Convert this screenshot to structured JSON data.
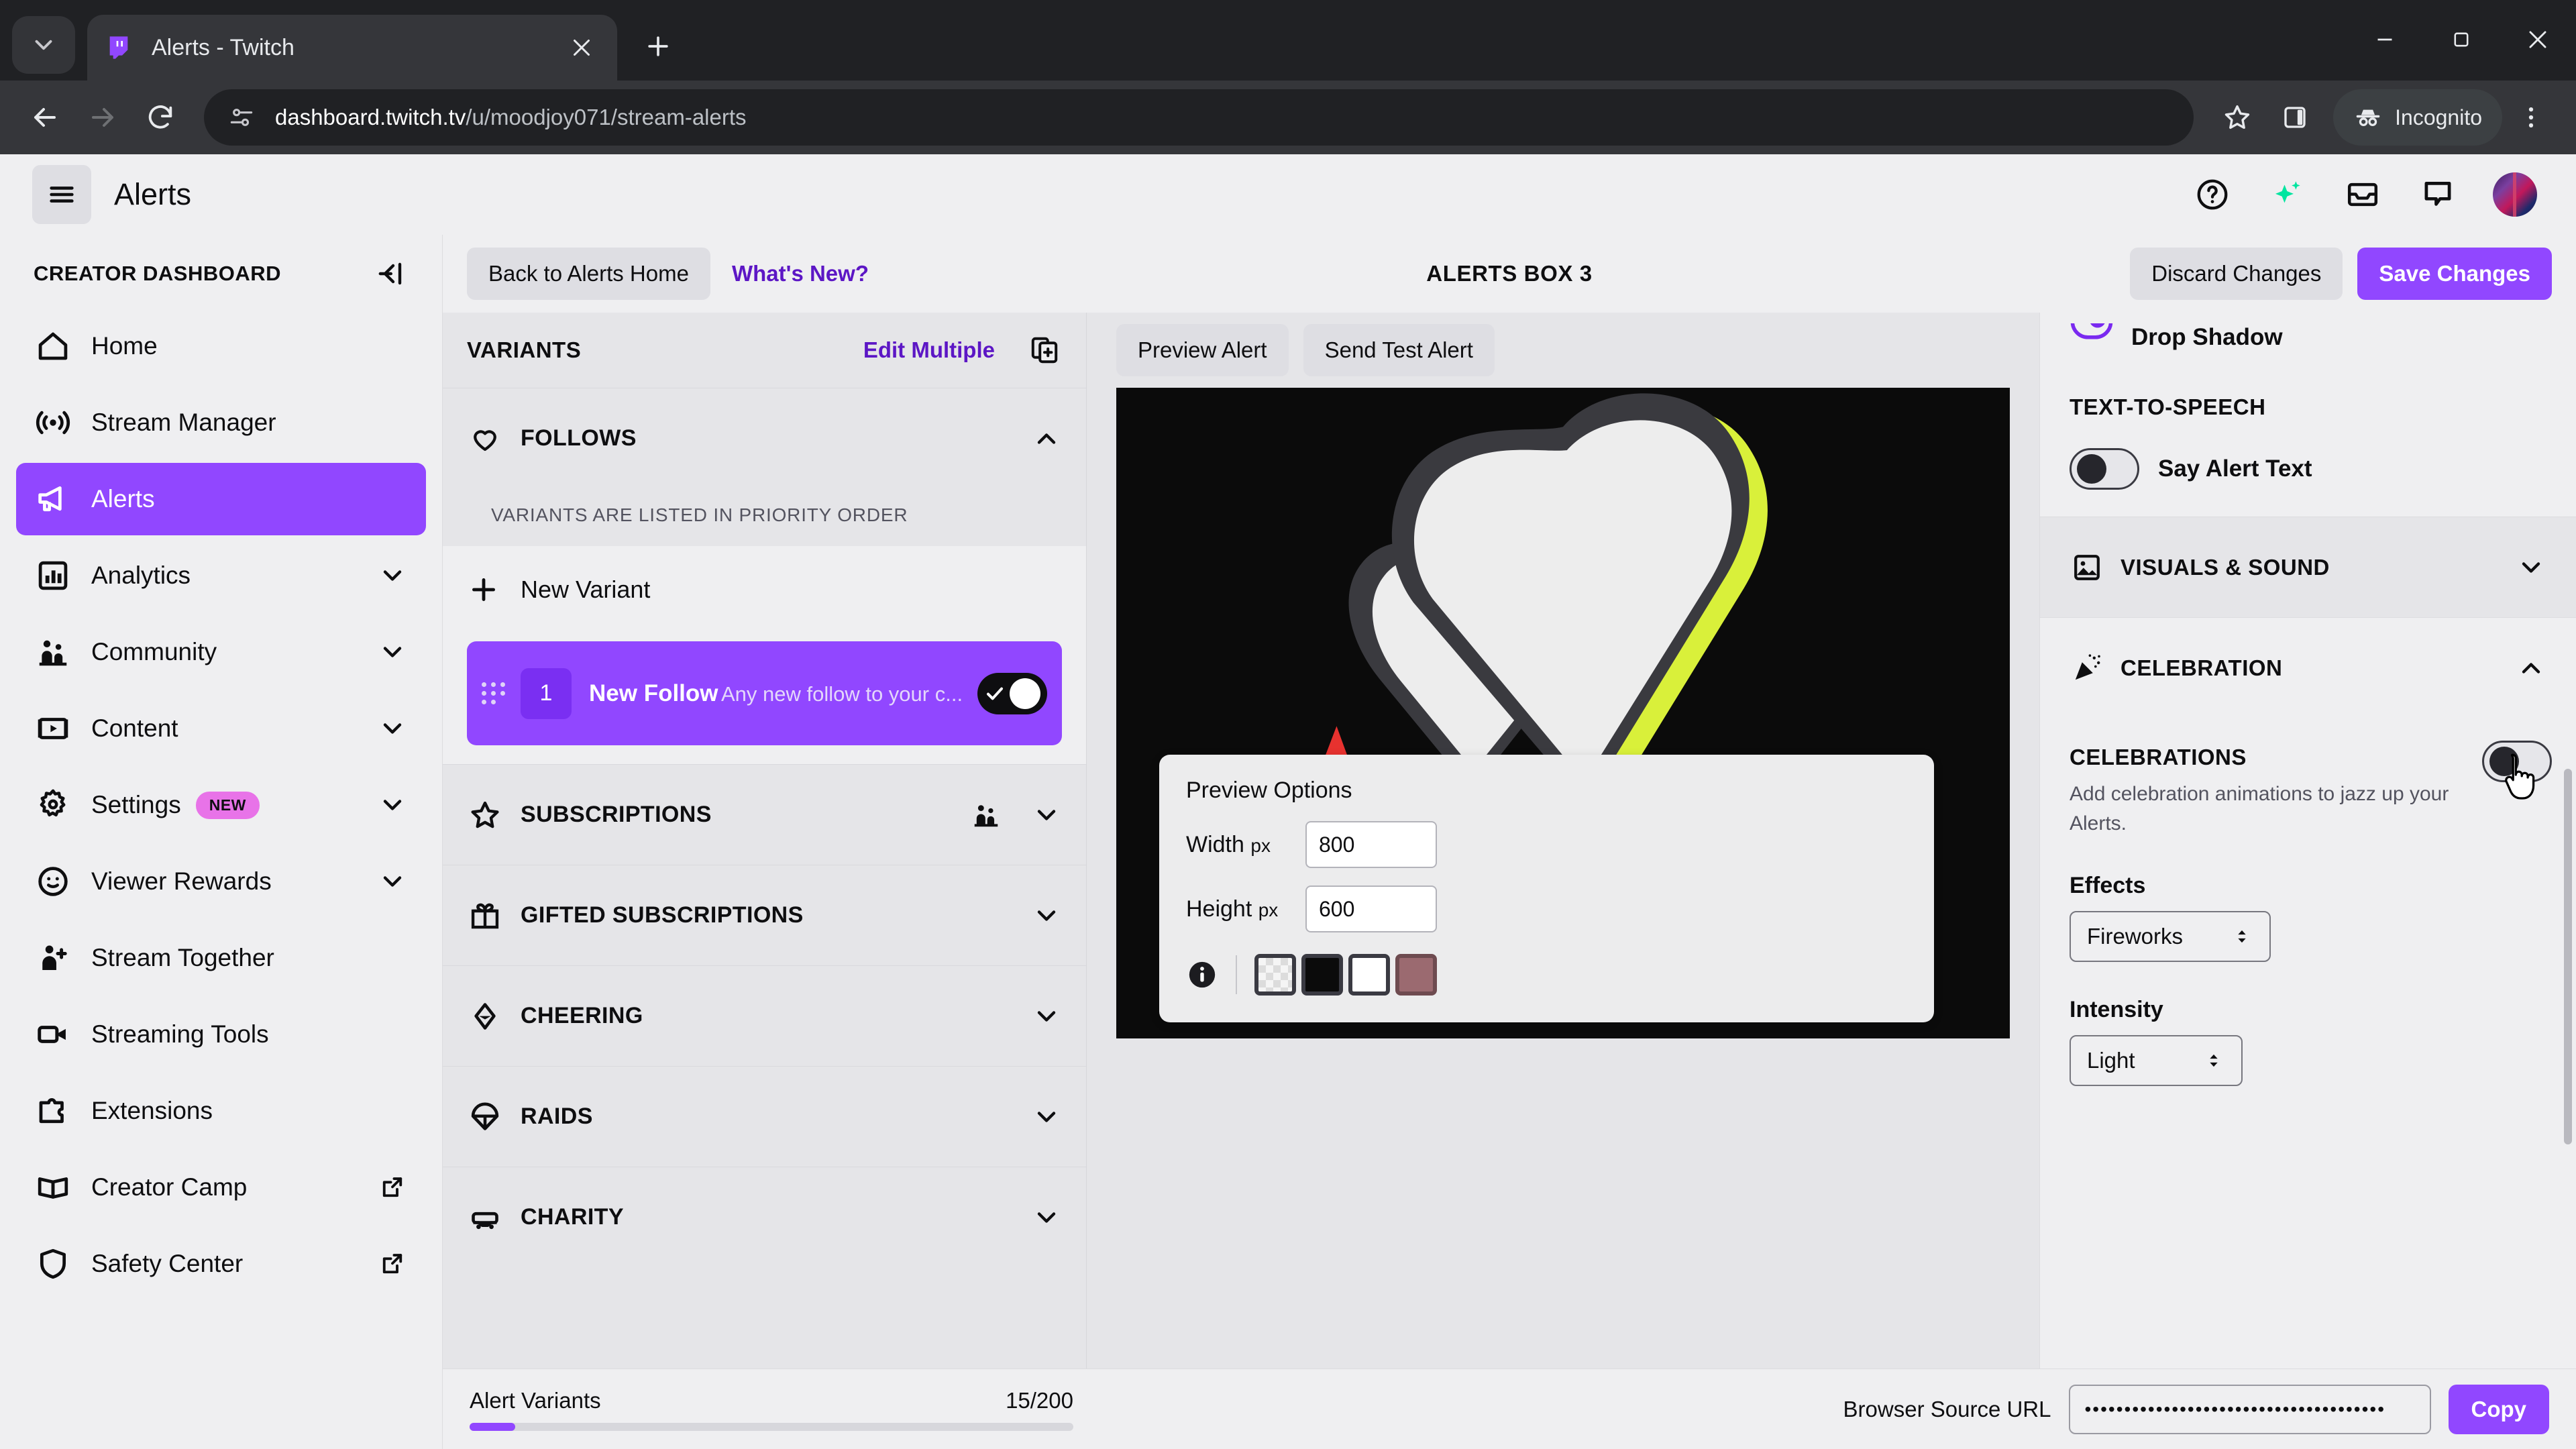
{
  "browser": {
    "tab": {
      "title": "Alerts - Twitch",
      "favicon": "twitch-icon"
    },
    "omnibox": {
      "host": "dashboard.twitch.tv",
      "path": "/u/moodjoy071/stream-alerts"
    },
    "profile_pill": "Incognito",
    "icons": {
      "tab_search": "chevron-down-icon",
      "new_tab": "plus-icon",
      "close_tab": "close-icon",
      "minimize": "minimize-icon",
      "maximize": "maximize-icon",
      "window_close": "close-icon",
      "back": "back-arrow-icon",
      "forward": "forward-arrow-icon",
      "reload": "reload-icon",
      "site_info": "site-settings-icon",
      "bookmark": "star-icon",
      "side_panel": "side-panel-icon",
      "incognito": "incognito-icon",
      "menu": "three-dot-menu-icon"
    }
  },
  "app_header": {
    "title": "Alerts",
    "icons": {
      "hamburger": "hamburger-menu-icon",
      "help": "help-circle-icon",
      "sparkle": "sparkle-icon",
      "inbox": "inbox-icon",
      "whispers": "speech-bubble-icon",
      "avatar": "user-avatar"
    }
  },
  "sidebar": {
    "heading": "CREATOR DASHBOARD",
    "collapse_icon": "collapse-sidebar-icon",
    "items": [
      {
        "label": "Home",
        "icon": "home-icon",
        "active": false,
        "chevron": false,
        "external": false,
        "badge": null
      },
      {
        "label": "Stream Manager",
        "icon": "broadcast-icon",
        "active": false,
        "chevron": false,
        "external": false,
        "badge": null
      },
      {
        "label": "Alerts",
        "icon": "megaphone-icon",
        "active": true,
        "chevron": false,
        "external": false,
        "badge": null
      },
      {
        "label": "Analytics",
        "icon": "bar-chart-icon",
        "active": false,
        "chevron": true,
        "external": false,
        "badge": null
      },
      {
        "label": "Community",
        "icon": "people-icon",
        "active": false,
        "chevron": true,
        "external": false,
        "badge": null
      },
      {
        "label": "Content",
        "icon": "video-frame-icon",
        "active": false,
        "chevron": true,
        "external": false,
        "badge": null
      },
      {
        "label": "Settings",
        "icon": "gear-icon",
        "active": false,
        "chevron": true,
        "external": false,
        "badge": "NEW"
      },
      {
        "label": "Viewer Rewards",
        "icon": "smiley-face-icon",
        "active": false,
        "chevron": true,
        "external": false,
        "badge": null
      },
      {
        "label": "Stream Together",
        "icon": "person-plus-icon",
        "active": false,
        "chevron": false,
        "external": false,
        "badge": null
      },
      {
        "label": "Streaming Tools",
        "icon": "video-camera-icon",
        "active": false,
        "chevron": false,
        "external": false,
        "badge": null
      },
      {
        "label": "Extensions",
        "icon": "puzzle-piece-icon",
        "active": false,
        "chevron": false,
        "external": false,
        "badge": null
      },
      {
        "label": "Creator Camp",
        "icon": "open-book-icon",
        "active": false,
        "chevron": false,
        "external": true,
        "badge": null
      },
      {
        "label": "Safety Center",
        "icon": "shield-icon",
        "active": false,
        "chevron": false,
        "external": true,
        "badge": null
      }
    ]
  },
  "content_toolbar": {
    "back_button": "Back to Alerts Home",
    "whats_new": "What's New?",
    "page_title": "ALERTS BOX 3",
    "discard": "Discard Changes",
    "save": "Save Changes"
  },
  "variants_panel": {
    "heading": "VARIANTS",
    "edit_multiple": "Edit Multiple",
    "duplicate_icon": "duplicate-icon",
    "priority_note": "VARIANTS ARE LISTED IN PRIORITY ORDER",
    "new_variant": "New Variant",
    "groups": [
      {
        "label": "FOLLOWS",
        "icon": "heart-icon",
        "expanded": true,
        "extra_icon": null
      },
      {
        "label": "SUBSCRIPTIONS",
        "icon": "star-icon",
        "expanded": false,
        "extra_icon": "people-icon"
      },
      {
        "label": "GIFTED SUBSCRIPTIONS",
        "icon": "gift-icon",
        "expanded": false,
        "extra_icon": null
      },
      {
        "label": "CHEERING",
        "icon": "bits-diamond-icon",
        "expanded": false,
        "extra_icon": null
      },
      {
        "label": "RAIDS",
        "icon": "parachute-icon",
        "expanded": false,
        "extra_icon": null
      },
      {
        "label": "CHARITY",
        "icon": "charity-icon",
        "expanded": false,
        "extra_icon": null
      }
    ],
    "variants": [
      {
        "number": "1",
        "title": "New Follow",
        "subtitle": "Any new follow to your c...",
        "enabled": true
      }
    ]
  },
  "preview": {
    "preview_alert": "Preview Alert",
    "send_test_alert": "Send Test Alert",
    "alert_art": "double-heart-illustration",
    "options": {
      "title": "Preview Options",
      "width_label": "Width",
      "width_unit": "px",
      "width_value": "800",
      "height_label": "Height",
      "height_unit": "px",
      "height_value": "600",
      "info_icon": "info-icon",
      "swatches": [
        {
          "name": "transparent-swatch",
          "color": "transparent",
          "selected": false
        },
        {
          "name": "black-swatch",
          "color": "#0b0b0b",
          "selected": true
        },
        {
          "name": "white-swatch",
          "color": "#ffffff",
          "selected": false
        },
        {
          "name": "mauve-swatch",
          "color": "#9b6a70",
          "selected": false
        }
      ]
    }
  },
  "right_panel": {
    "drop_shadow_label": "Drop Shadow",
    "tts": {
      "heading": "TEXT-TO-SPEECH",
      "toggle_label": "Say Alert Text",
      "toggle_on": false
    },
    "sections": [
      {
        "label": "VISUALS & SOUND",
        "icon": "image-icon",
        "expanded": false
      },
      {
        "label": "CELEBRATION",
        "icon": "confetti-icon",
        "expanded": true
      }
    ],
    "celebrations": {
      "title": "CELEBRATIONS",
      "description": "Add celebration animations to jazz up your Alerts.",
      "toggle_on": false,
      "effects_label": "Effects",
      "effects_value": "Fireworks",
      "intensity_label": "Intensity",
      "intensity_value": "Light"
    }
  },
  "bottom_bar": {
    "variants_label": "Alert Variants",
    "variants_count": "15/200",
    "progress_percent": 7.5,
    "browser_source_url_label": "Browser Source URL",
    "browser_source_url_value": "••••••••••••••••••••••••••••••••••••••",
    "copy_label": "Copy"
  },
  "colors": {
    "twitch_purple": "#9147ff",
    "twitch_purple_dark": "#5c16c5",
    "page_bg": "#efeff1",
    "panel_bg": "#e5e5e8",
    "badge_pink": "#e873e8"
  }
}
